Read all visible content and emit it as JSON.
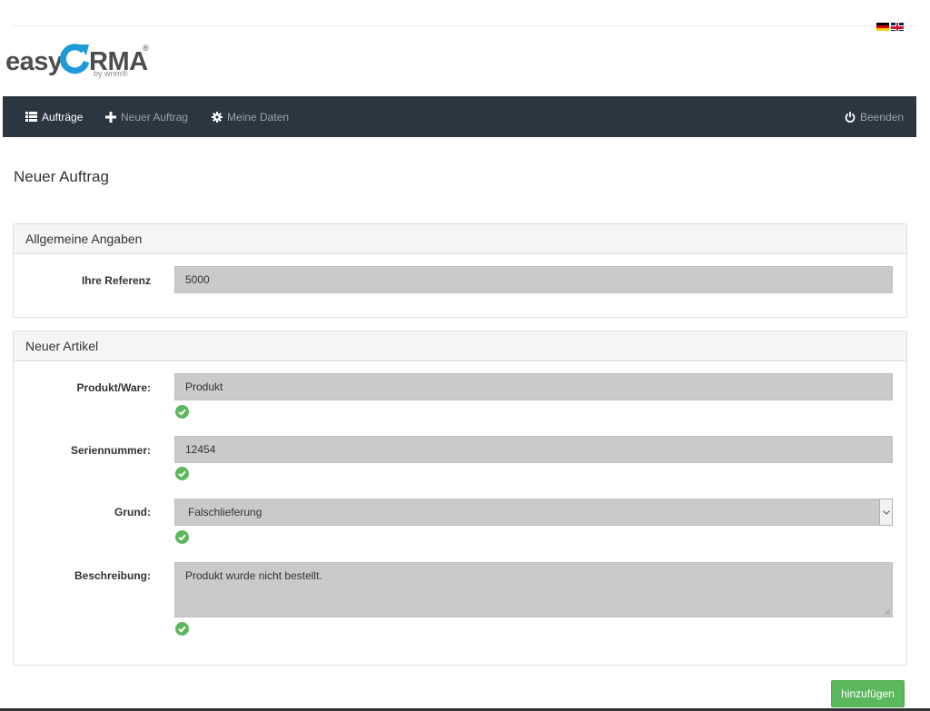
{
  "logo": {
    "easy": "easy",
    "rma": "RMA",
    "registered": "®",
    "by": "by wnm®"
  },
  "languages": [
    "de",
    "en"
  ],
  "nav": {
    "orders": "Aufträge",
    "new_order": "Neuer Auftrag",
    "my_data": "Meine Daten",
    "logout": "Beenden"
  },
  "page": {
    "title": "Neuer Auftrag"
  },
  "general": {
    "heading": "Allgemeine Angaben",
    "reference_label": "Ihre Referenz",
    "reference_value": "5000"
  },
  "article": {
    "heading": "Neuer Artikel",
    "product_label": "Produkt/Ware:",
    "product_value": "Produkt",
    "serial_label": "Seriennummer:",
    "serial_value": "12454",
    "reason_label": "Grund:",
    "reason_value": "Falschlieferung",
    "description_label": "Beschreibung:",
    "description_value": "Produkt wurde nicht bestellt."
  },
  "actions": {
    "add": "hinzufügen"
  },
  "colors": {
    "navbar": "#2c3640",
    "accent": "#1e9bd7",
    "success": "#5cb85c",
    "field": "#cacaca"
  }
}
